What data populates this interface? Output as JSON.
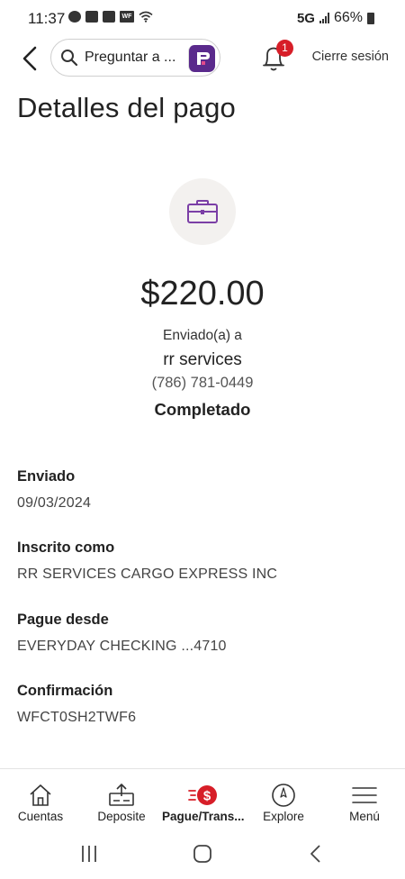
{
  "status_bar": {
    "time": "11:37",
    "network": "5G",
    "battery": "66%"
  },
  "header": {
    "search_placeholder": "Preguntar a ...",
    "notification_count": "1",
    "logout_label": "Cierre sesión"
  },
  "page_title": "Detalles del pago",
  "payment": {
    "amount": "$220.00",
    "sent_to_label": "Enviado(a) a",
    "recipient_name": "rr services",
    "recipient_phone": "(786) 781-0449",
    "status": "Completado"
  },
  "details": [
    {
      "label": "Enviado",
      "value": "09/03/2024"
    },
    {
      "label": "Inscrito como",
      "value": "RR SERVICES CARGO EXPRESS INC"
    },
    {
      "label": "Pague desde",
      "value": "EVERYDAY CHECKING ...4710"
    },
    {
      "label": "Confirmación",
      "value": "WFCT0SH2TWF6"
    }
  ],
  "bottom_nav": {
    "items": [
      {
        "label": "Cuentas",
        "icon": "home-icon"
      },
      {
        "label": "Deposite",
        "icon": "deposit-icon"
      },
      {
        "label": "Pague/Trans...",
        "icon": "pay-transfer-icon",
        "active": true
      },
      {
        "label": "Explore",
        "icon": "compass-icon"
      },
      {
        "label": "Menú",
        "icon": "hamburger-icon"
      }
    ]
  },
  "colors": {
    "brand_red": "#d71e28",
    "brand_purple": "#5a2a8c",
    "icon_circle_bg": "#f3f1ef"
  }
}
